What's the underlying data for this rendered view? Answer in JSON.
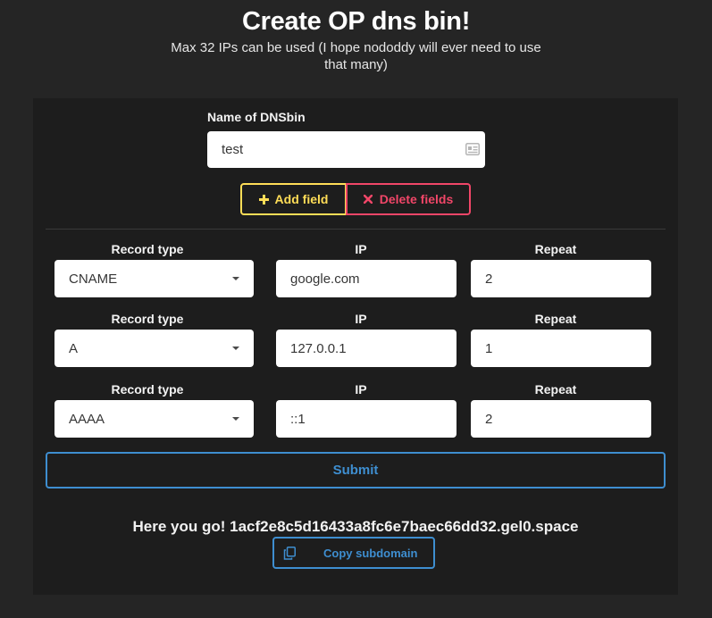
{
  "header": {
    "title": "Create OP dns bin!",
    "subtitle": "Max 32 IPs can be used (I hope nododdy will ever need to use that many)"
  },
  "form": {
    "name_label": "Name of DNSbin",
    "name_value": "test",
    "add_label": "Add field",
    "delete_label": "Delete fields",
    "columns": {
      "type": "Record type",
      "ip": "IP",
      "repeat": "Repeat"
    },
    "records": [
      {
        "type": "CNAME",
        "ip": "google.com",
        "repeat": "2"
      },
      {
        "type": "A",
        "ip": "127.0.0.1",
        "repeat": "1"
      },
      {
        "type": "AAAA",
        "ip": "::1",
        "repeat": "2"
      }
    ],
    "submit_label": "Submit"
  },
  "result": {
    "text": "Here you go! 1acf2e8c5d16433a8fc6e7baec66dd32.gel0.space",
    "copy_label": "Copy subdomain"
  },
  "colors": {
    "background": "#252525",
    "panel": "#1d1d1d",
    "warning": "#ffdd57",
    "danger": "#f14668",
    "info": "#3e8ed0"
  }
}
